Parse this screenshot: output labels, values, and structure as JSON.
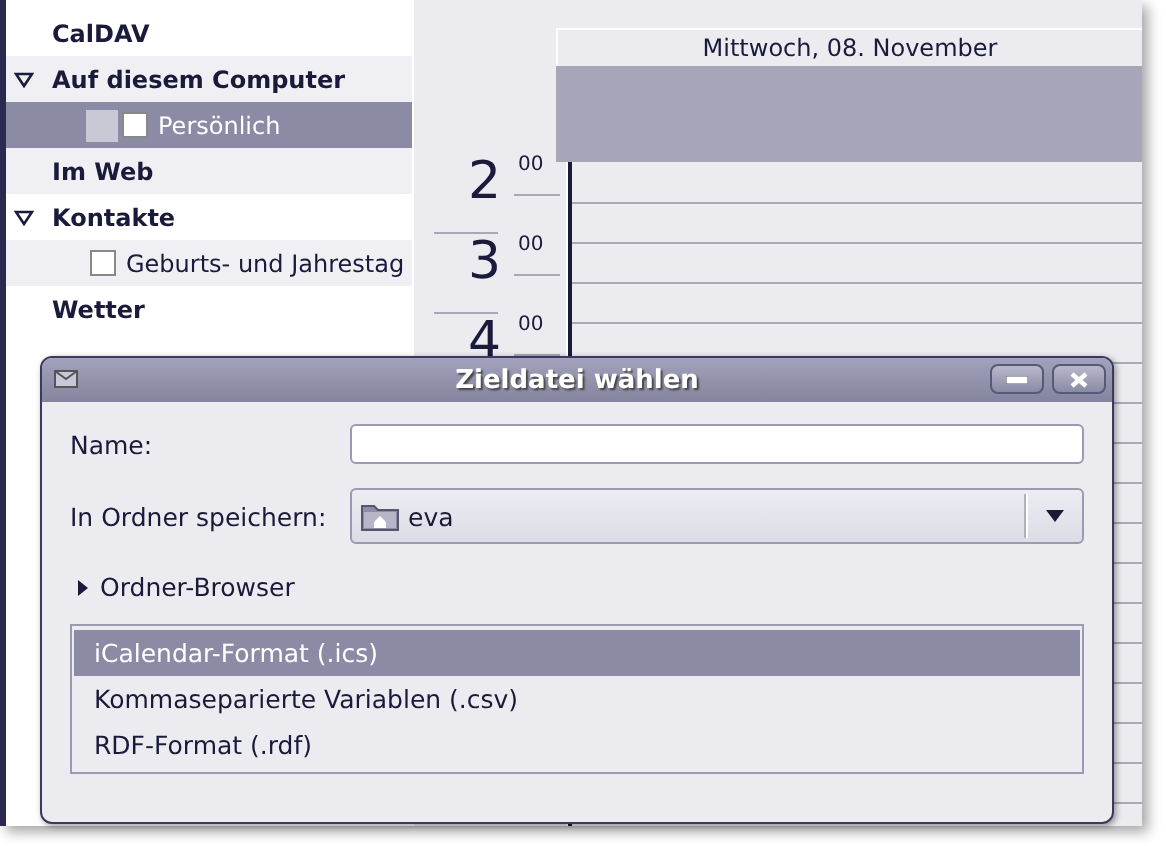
{
  "sidebar": {
    "groups": [
      {
        "label": "CalDAV"
      },
      {
        "label": "Auf diesem Computer",
        "expanded": true,
        "children": [
          {
            "label": "Persönlich",
            "selected": true,
            "checked": false,
            "color": "#c9c9d6"
          }
        ]
      },
      {
        "label": "Im Web"
      },
      {
        "label": "Kontakte",
        "expanded": true,
        "children": [
          {
            "label": "Geburts- und Jahrestag",
            "selected": false,
            "checked": false
          }
        ]
      },
      {
        "label": "Wetter"
      }
    ]
  },
  "calendar": {
    "day_header": "Mittwoch, 08. November",
    "hours": [
      {
        "hour": "2",
        "minutes": "00"
      },
      {
        "hour": "3",
        "minutes": "00"
      },
      {
        "hour": "4",
        "minutes": "00"
      }
    ]
  },
  "dialog": {
    "title": "Zieldatei wählen",
    "name_label": "Name:",
    "folder_label": "In Ordner speichern:",
    "folder_value": "eva",
    "browser_expander": {
      "label": "Ordner-Browser",
      "expanded": false
    },
    "formats": [
      {
        "label": "iCalendar-Format (.ics)",
        "selected": true
      },
      {
        "label": "Kommaseparierte Variablen (.csv)",
        "selected": false
      },
      {
        "label": "RDF-Format (.rdf)",
        "selected": false
      }
    ]
  }
}
